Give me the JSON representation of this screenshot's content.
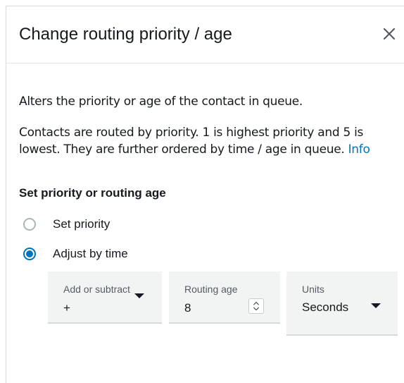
{
  "dialog": {
    "title": "Change routing priority / age",
    "close_icon": "close-icon"
  },
  "description": {
    "line1": "Alters the priority or age of the contact in queue.",
    "line2": "Contacts are routed by priority. 1 is highest priority and 5 is lowest. They are further ordered by time / age in queue.",
    "info_link": "Info"
  },
  "section": {
    "title": "Set priority or routing age"
  },
  "options": [
    {
      "label": "Set priority",
      "selected": false
    },
    {
      "label": "Adjust by time",
      "selected": true
    }
  ],
  "fields": {
    "operation": {
      "label": "Add or subtract",
      "value": "+"
    },
    "routing_age": {
      "label": "Routing age",
      "value": "8"
    },
    "units": {
      "label": "Units",
      "value": "Seconds"
    }
  },
  "colors": {
    "accent": "#0073bb",
    "field_bg": "#f2f3f3"
  }
}
